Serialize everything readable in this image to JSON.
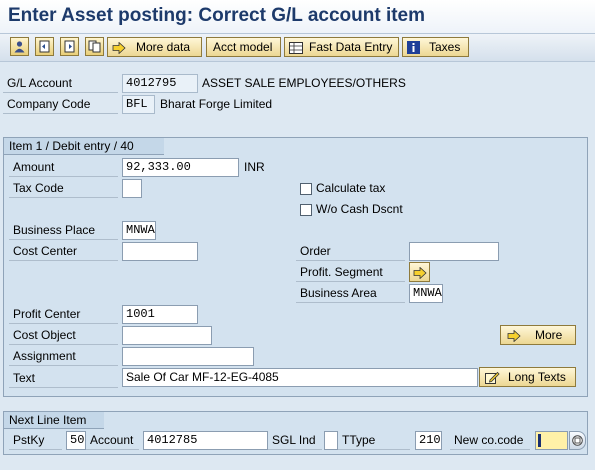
{
  "title": "Enter Asset posting: Correct G/L account item",
  "toolbar": {
    "more_data": "More data",
    "acct_model": "Acct model",
    "fast_data_entry": "Fast Data Entry",
    "taxes": "Taxes"
  },
  "header": {
    "gl_account_label": "G/L Account",
    "gl_account_value": "4012795",
    "gl_account_desc": "ASSET SALE EMPLOYEES/OTHERS",
    "company_code_label": "Company Code",
    "company_code_value": "BFL",
    "company_code_desc": "Bharat Forge Limited"
  },
  "item": {
    "title": "Item 1 / Debit entry / 40",
    "amount_label": "Amount",
    "amount_value": "92,333.00",
    "currency": "INR",
    "tax_code_label": "Tax Code",
    "tax_code_value": "",
    "calculate_tax_label": "Calculate tax",
    "calculate_tax_checked": false,
    "wo_cash_dscnt_label": "W/o Cash Dscnt",
    "wo_cash_dscnt_checked": false,
    "business_place_label": "Business Place",
    "business_place_value": "MNWA",
    "cost_center_label": "Cost Center",
    "cost_center_value": "",
    "order_label": "Order",
    "order_value": "",
    "profit_segment_label": "Profit. Segment",
    "business_area_label": "Business Area",
    "business_area_value": "MNWA",
    "profit_center_label": "Profit Center",
    "profit_center_value": "1001",
    "cost_object_label": "Cost Object",
    "cost_object_value": "",
    "more_label": "More",
    "assignment_label": "Assignment",
    "assignment_value": "",
    "text_label": "Text",
    "text_value": "Sale Of Car MF-12-EG-4085",
    "long_texts_label": "Long Texts"
  },
  "next_line": {
    "title": "Next Line Item",
    "pstky_label": "PstKy",
    "pstky_value": "50",
    "account_label": "Account",
    "account_value": "4012785",
    "sgl_ind_label": "SGL Ind",
    "sgl_ind_value": "",
    "ttype_label": "TType",
    "ttype_value": "210",
    "new_cocode_label": "New co.code",
    "new_cocode_value": ""
  },
  "colors": {
    "title_text": "#1d3a6b",
    "background": "#dde8f2",
    "group_background": "#d3e2ef",
    "button_yellow": "#ecd793"
  }
}
